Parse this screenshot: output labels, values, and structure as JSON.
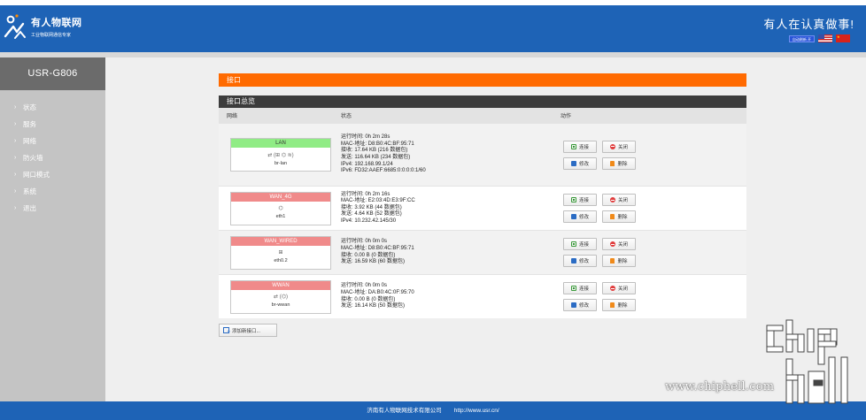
{
  "header": {
    "brand_name": "有人物联网",
    "brand_tagline": "工业物联网通信专家",
    "slogan": "有人在认真做事!",
    "auto_refresh": "自动刷新 开"
  },
  "sidebar": {
    "device_name": "USR-G806",
    "items": [
      {
        "label": "状态"
      },
      {
        "label": "服务"
      },
      {
        "label": "网络"
      },
      {
        "label": "防火墙"
      },
      {
        "label": "网口模式"
      },
      {
        "label": "系统"
      },
      {
        "label": "退出"
      }
    ]
  },
  "main": {
    "section_title": "接口",
    "overview_title": "接口总览",
    "columns": {
      "network": "网络",
      "status": "状态",
      "actions": "动作"
    },
    "actions": {
      "connect": "连接",
      "close": "关闭",
      "edit": "修改",
      "delete": "删除"
    },
    "add_button": "添加新接口...",
    "interfaces": [
      {
        "name": "LAN",
        "state_color": "#90ec85",
        "icons": "⇄ (⊞ ⌬ ≋)",
        "device": "br-lan",
        "status": [
          "运行时间: 0h 2m 28s",
          "MAC-地址: D8:B0:4C:BF:95:71",
          "接收: 17.64 KB (216 数据包)",
          "发送: 116.64 KB (234 数据包)",
          "IPv4: 192.168.99.1/24",
          "IPv6: FD32:AAEF:6685:0:0:0:0:1/60"
        ]
      },
      {
        "name": "WAN_4G",
        "state_color": "#f08a8a",
        "icons": "⌬",
        "device": "eth1",
        "status": [
          "运行时间: 0h 2m 16s",
          "MAC-地址: E2:03:4D:E3:9F:CC",
          "接收: 3.92 KB (44 数据包)",
          "发送: 4.64 KB (52 数据包)",
          "IPv4: 10.232.42.145/30"
        ]
      },
      {
        "name": "WAN_WIRED",
        "state_color": "#f08a8a",
        "icons": "⊞",
        "device": "eth0.2",
        "status": [
          "运行时间: 0h 0m 0s",
          "MAC-地址: D8:B0:4C:BF:95:71",
          "接收: 0.00 B (0 数据包)",
          "发送: 16.59 KB (60 数据包)"
        ]
      },
      {
        "name": "WWAN",
        "state_color": "#f08a8a",
        "icons": "⇄ (⌬)",
        "device": "br-wwan",
        "status": [
          "运行时间: 0h 0m 0s",
          "MAC-地址: DA:B0:4C:0F:95:70",
          "接收: 0.00 B (0 数据包)",
          "发送: 16.14 KB (50 数据包)"
        ]
      }
    ]
  },
  "footer": {
    "company": "济南有人物联网技术有限公司",
    "url": "http://www.usr.cn/"
  },
  "watermark": {
    "site": "www.chiphell.com"
  },
  "colors": {
    "brand_blue": "#1e63b6",
    "accent_orange": "#ff6a00",
    "dark_bar": "#3c3c3c",
    "sidebar_gray": "#c4c4c4",
    "up_green": "#90ec85",
    "down_red": "#f08a8a"
  }
}
